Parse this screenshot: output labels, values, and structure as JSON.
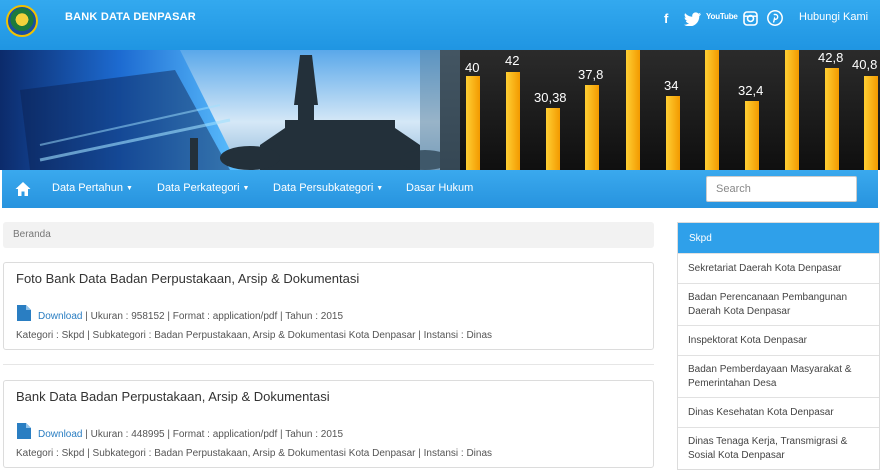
{
  "header": {
    "brand": "BANK DATA DENPASAR",
    "social": [
      "f",
      "YouTube"
    ],
    "contact_label": "Hubungi Kami"
  },
  "banner": {
    "bar_labels": [
      "40",
      "42",
      "30,38",
      "37,8",
      "34",
      "32,4",
      "42,8",
      "40,8"
    ]
  },
  "nav": {
    "items": [
      {
        "label": "Data Pertahun",
        "caret": "▼"
      },
      {
        "label": "Data Perkategori",
        "caret": "▼"
      },
      {
        "label": "Data Persubkategori",
        "caret": "▼"
      },
      {
        "label": "Dasar Hukum",
        "caret": ""
      }
    ],
    "search_placeholder": "Search"
  },
  "breadcrumb": "Beranda",
  "documents": [
    {
      "title": "Foto Bank Data Badan Perpustakaan, Arsip & Dokumentasi",
      "download_label": "Download",
      "info": " | Ukuran : 958152 | Format : application/pdf | Tahun : 2015",
      "category": "Kategori : Skpd | Subkategori : Badan Perpustakaan, Arsip & Dokumentasi Kota Denpasar | Instansi : Dinas"
    },
    {
      "title": "Bank Data Badan Perpustakaan, Arsip & Dokumentasi",
      "download_label": "Download",
      "info": " | Ukuran : 448995 | Format : application/pdf | Tahun : 2015",
      "category": "Kategori : Skpd | Subkategori : Badan Perpustakaan, Arsip & Dokumentasi Kota Denpasar | Instansi : Dinas"
    }
  ],
  "sidebar": {
    "heading": "Skpd",
    "items": [
      "Sekretariat Daerah Kota Denpasar",
      "Badan Perencanaan Pembangunan Daerah Kota Denpasar",
      "Inspektorat Kota Denpasar",
      "Badan Pemberdayaan Masyarakat & Pemerintahan Desa",
      "Dinas Kesehatan Kota Denpasar",
      "Dinas Tenaga Kerja, Transmigrasi & Sosial Kota Denpasar"
    ]
  },
  "colors": {
    "primary_blue": "#2fa0ea",
    "link_blue": "#2a7ec2",
    "bar_orange": "#f5a300"
  }
}
